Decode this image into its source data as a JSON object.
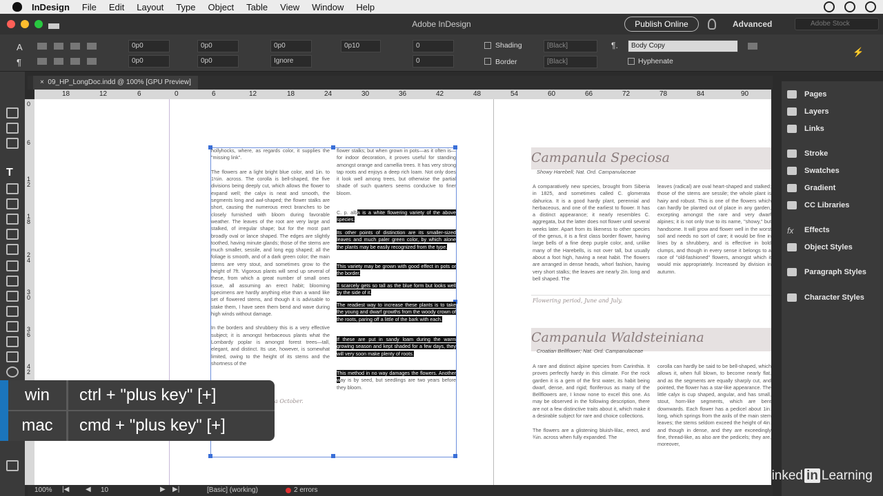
{
  "menubar": {
    "app": "InDesign",
    "items": [
      "File",
      "Edit",
      "Layout",
      "Type",
      "Object",
      "Table",
      "View",
      "Window",
      "Help"
    ]
  },
  "window": {
    "title": "Adobe InDesign",
    "publish": "Publish Online",
    "workspace": "Advanced",
    "search_placeholder": "Adobe Stock"
  },
  "control": {
    "f1": "0p0",
    "f2": "0p0",
    "f3": "0p0",
    "f4": "0p0",
    "f5": "0p0",
    "f6": "0p10",
    "f7": "0",
    "f8": "0",
    "ignore": "Ignore",
    "shading": "Shading",
    "border": "Border",
    "black1": "[Black]",
    "black2": "[Black]",
    "style": "Body Copy",
    "hyphenate": "Hyphenate"
  },
  "document": {
    "tab": "09_HP_LongDoc.indd @ 100% [GPU Preview]"
  },
  "ruler": {
    "h": [
      "18",
      "12",
      "6",
      "0",
      "6",
      "12",
      "18",
      "24",
      "30",
      "36",
      "42",
      "48",
      "54",
      "60",
      "66",
      "72",
      "78",
      "84",
      "90"
    ],
    "v": [
      "0",
      "6",
      "1 2",
      "1 8",
      "2 4",
      "3 0",
      "3 6",
      "4 2"
    ]
  },
  "left_page": {
    "col1": "hollyhocks, where, as regards color, it supplies the \"missing link\".\n\nThe flowers are a light bright blue color, and 1in. to 1½in. across. The corolla is bell-shaped, the five divisions being deeply cut, which allows the flower to expand well; the calyx is neat and smooth, the segments long and awl-shaped; the flower stalks are short, causing the numerous erect branches to be closely furnished with bloom during favorable weather. The leaves of the root are very large and stalked, of irregular shape; but for the most part broadly oval or lance shaped. The edges are slightly toothed, having minute glands; those of the stems are much smaller, sessile, and long egg shaped; all the foliage is smooth, and of a dark green color; the main stems are very stout, and sometimes grow to the height of 7ft. Vigorous plants will send up several of these, from which a great number of small ones issue, all assuming an erect habit; blooming specimens are hardly anything else than a wand like set of flowered stems, and though it is advisable to stake them, I have seen them bend and wave during high winds without damage.\n\nIn the borders and shrubbery this is a very effective subject; it is amongst herbaceous plants what the Lombardy poplar is amongst forest trees—tall, elegant, and distinct. Its use, however, is somewhat limited, owing to the height of its stems and the shortness of the",
    "col2_top": "flower stalks; but when grown in pots—as it often is—for indoor decoration, it proves useful for standing amongst orange and camellia trees. It has very strong tap roots and enjoys a deep rich loam. Not only does it look well among trees, but otherwise the partial shade of such quarters seems conducive to finer bloom.",
    "alba_pre": "C. p. alb",
    "alba_hl": "a is a white flowering variety of the above species.",
    "p2": "Its other points of distinction are its smaller-sized leaves and much paler green color, by which alone the plants may be easily recognized from the type.",
    "p3": "This variety may be grown with good effect in pots or the border.",
    "p4": "It scarcely gets so tall as the blue form but looks well by the side of it.",
    "p5": "The readiest way to increase these plants is to take the young and dwarf growths from the woody crown of the roots, paring off a little of the bark with each.",
    "p6": "If these are put in sandy loam during the warm growing season and kept shaded for a few days, they will very soon make plenty of roots.",
    "p7_hl": "This method in no way damages the flowers. Another w",
    "p7_rest": "ay is by seed, but seedlings are two years before they bloom.",
    "caption": "a October."
  },
  "right_page": {
    "h1": "Campanula Speciosa",
    "s1": "Showy Harebell; Nat. Ord. Campanulaceae",
    "a1": "A comparatively new species, brought from Siberia in 1825, and sometimes called C. glomerata dahurica. It is a good hardy plant, perennial and herbaceous, and one of the earliest to flower. It has a distinct appearance; it nearly resembles C. aggregata, but the latter does not flower until several weeks later. Apart from its likeness to other species of the genus, it is a first class border flower, having large bells of a fine deep purple color, and, unlike many of the Harebells, is not over tall, but usually about a foot high, having a neat habit. The flowers are arranged in dense heads, whorl fashion, having very short stalks; the leaves are nearly 2in. long and bell shaped. The",
    "b1": "leaves (radical) are oval heart-shaped and stalked; those of the stems are sessile; the whole plant is hairy and robust. This is one of the flowers which can hardly be planted out of place in any garden, excepting amongst the rare and very dwarf alpines; it is not only true to its name, \"showy,\" but handsome. It will grow and flower well in the worst soil and needs no sort of care; it would be fine in lines by a shrubbery, and is effective in bold clumps, and though in every sense it belongs to a race of \"old-fashioned\" flowers, amongst which it would mix appropriately. Increased by division in autumn.",
    "c1": "Flowering period, June and July.",
    "h2": "Campanula Waldsteiniana",
    "s2": "Croatian Bellflower; Nat. Ord. Campanulaceae",
    "a2": "A rare and distinct alpine species from Carinthia. It proves perfectly hardy in this climate. For the rock garden it is a gem of the first water, its habit being dwarf, dense, and rigid; floriferous as many of the Bellflowers are, I know none to excel this one. As may be observed in the following description, there are not a few distinctive traits about it, which make it a desirable subject for rare and choice collections.\n\nThe flowers are a glistening bluish-lilac, erect, and ¾in. across when fully expanded. The",
    "b2": "corolla can hardly be said to be bell-shaped, which allows it, when full blown, to become nearly flat, and as the segments are equally sharply cut, and pointed, the flower has a star-like appearance. The little calyx is cup shaped, angular, and has small, stout, horn-like segments, which are bent downwards. Each flower has a pedicel about 1in. long, which springs from the axils of the main stem leaves; the stems seldom exceed the height of 4in. and though in dense, and they are exceedingly fine, thread-like, as also are the pedicels; they are, moreover,"
  },
  "panels": [
    "Pages",
    "Layers",
    "Links",
    "Stroke",
    "Swatches",
    "Gradient",
    "CC Libraries",
    "Effects",
    "Object Styles",
    "Paragraph Styles",
    "Character Styles"
  ],
  "shortcut": {
    "win_key": "win",
    "win_val": "ctrl + \"plus key\" [+]",
    "mac_key": "mac",
    "mac_val": "cmd + \"plus key\" [+]"
  },
  "status": {
    "zoom": "100%",
    "page": "10",
    "style": "[Basic] (working)",
    "errors": "2 errors"
  },
  "watermark": "Linked in Learning",
  "watermark_parts": {
    "a": "Linked",
    "b": "in",
    "c": "Learning"
  }
}
